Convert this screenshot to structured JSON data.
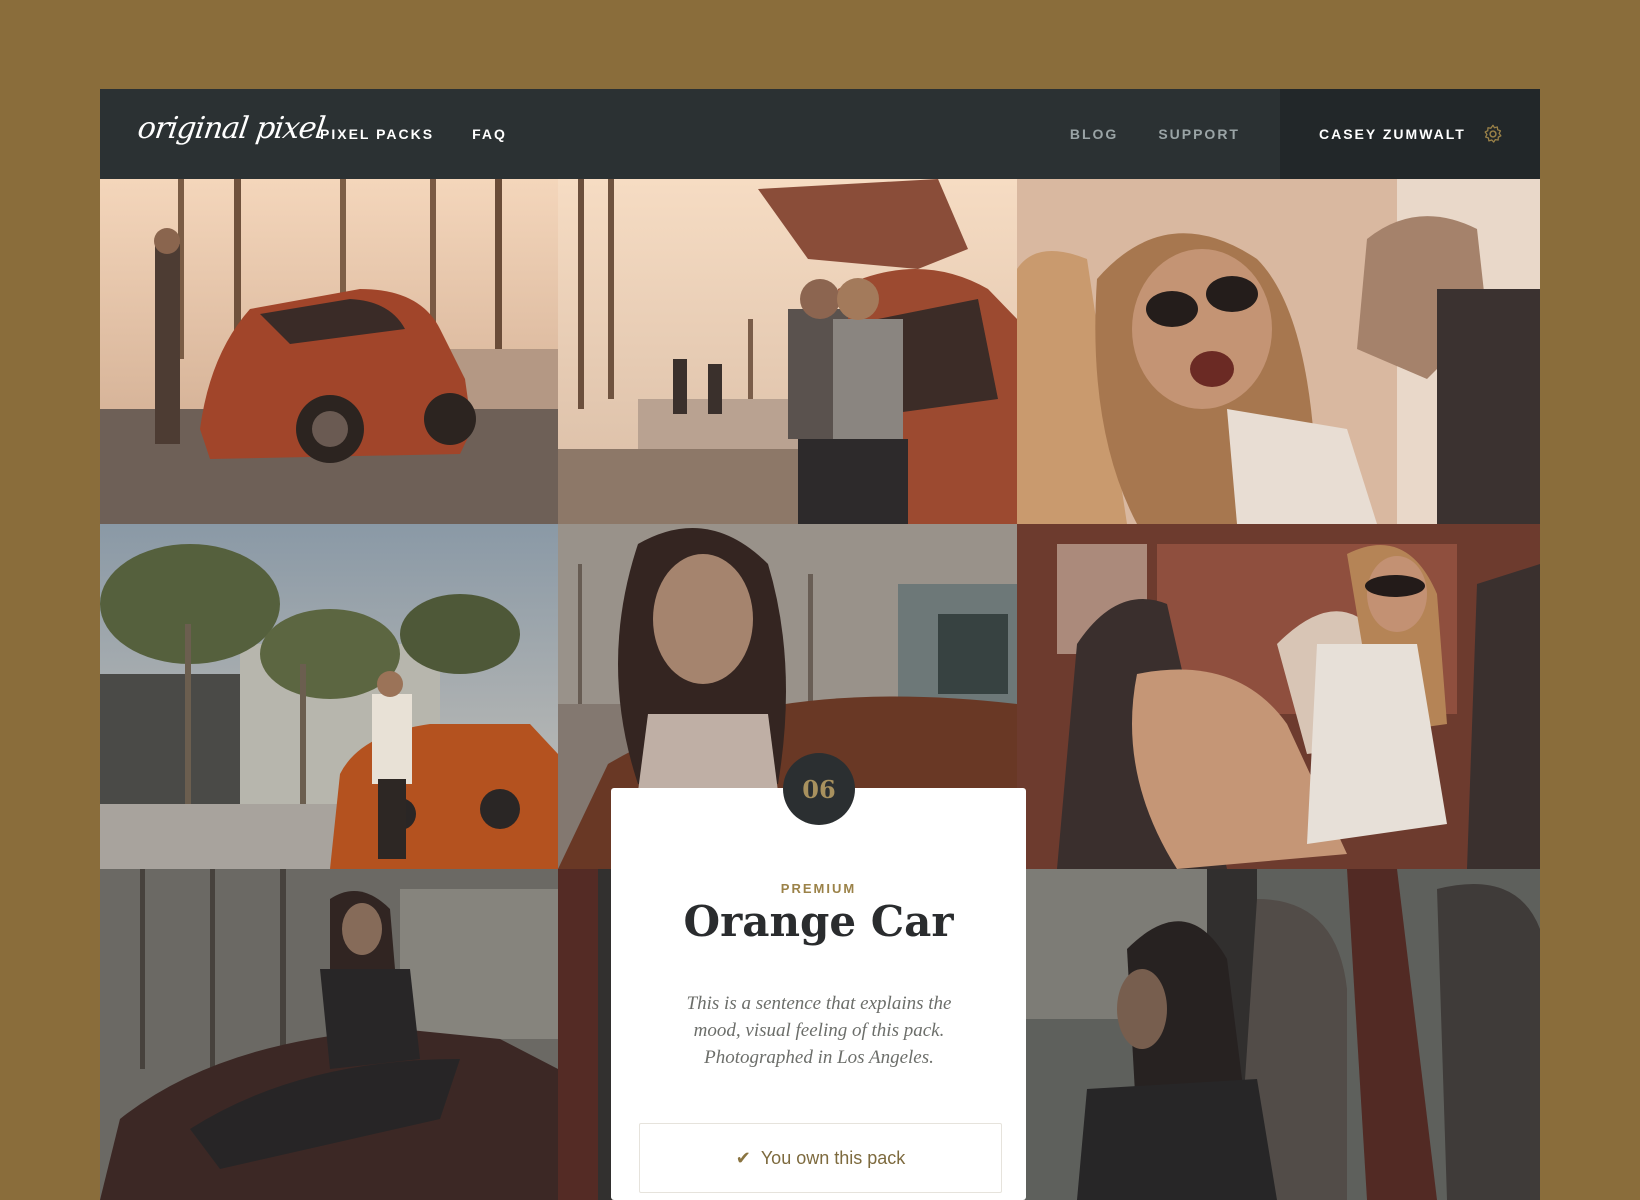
{
  "header": {
    "logo": "original pixel",
    "nav_left": [
      "PIXEL PACKS",
      "FAQ"
    ],
    "nav_right": [
      "BLOG",
      "SUPPORT"
    ],
    "user_name": "CASEY ZUMWALT",
    "settings_icon": "gear-icon"
  },
  "gallery": {
    "photos": [
      {
        "name": "photo-man-leaning-on-car"
      },
      {
        "name": "photo-couple-at-trunk"
      },
      {
        "name": "photo-woman-sunglasses-laughing"
      },
      {
        "name": "photo-woman-sitting-on-car-hood"
      },
      {
        "name": "photo-woman-portrait-palms"
      },
      {
        "name": "photo-woman-in-car-seat"
      },
      {
        "name": "photo-woman-leaning-on-car-roof"
      },
      {
        "name": "photo-woman-driving"
      }
    ]
  },
  "pack": {
    "number": "06",
    "tier": "PREMIUM",
    "title": "Orange Car",
    "description": "This is a sentence that explains the mood, visual feeling of this pack. Photographed in Los Angeles.",
    "owned_label": "You own this pack",
    "owned_icon": "checkmark-icon"
  },
  "colors": {
    "page_background": "#8a6d3b",
    "header_background": "#2b3133",
    "accent_gold": "#9b8248",
    "badge_background": "#2b2f31"
  }
}
